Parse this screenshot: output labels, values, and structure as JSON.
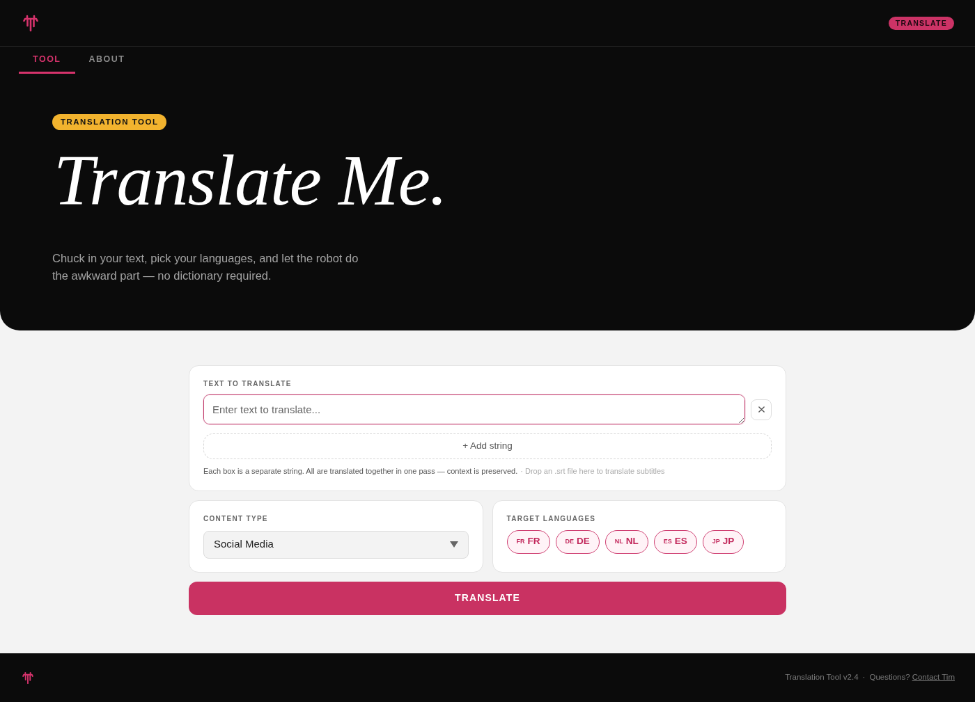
{
  "header": {
    "button": "TRANSLATE"
  },
  "tabs": [
    {
      "label": "TOOL",
      "selected": true
    },
    {
      "label": "ABOUT",
      "selected": false
    }
  ],
  "hero": {
    "tag": "TRANSLATION TOOL",
    "title": "Translate Me.",
    "description": "Chuck in your text, pick your languages, and let the robot do the awkward part — no dictionary required."
  },
  "text_panel": {
    "label": "TEXT TO TRANSLATE",
    "strings": [
      {
        "placeholder": "Enter text to translate...",
        "focused": true
      }
    ],
    "add_button": "+ Add string",
    "help": "Each box is a separate string. All are translated together in one pass — context is preserved.",
    "drop_hint": "· Drop an .srt file here to translate subtitles"
  },
  "content_type": {
    "label": "CONTENT TYPE",
    "value": "Social Media"
  },
  "target_languages": {
    "label": "TARGET LANGUAGES",
    "languages": [
      {
        "short": "FR",
        "label": "FR",
        "selected": true
      },
      {
        "short": "DE",
        "label": "DE",
        "selected": true
      },
      {
        "short": "NL",
        "label": "NL",
        "selected": true
      },
      {
        "short": "ES",
        "label": "ES",
        "selected": true
      },
      {
        "short": "JP",
        "label": "JP",
        "selected": true
      }
    ]
  },
  "translate_button": "TRANSLATE",
  "footer": {
    "version": "Translation Tool v2.4",
    "separator": "·",
    "question": "Questions?",
    "link": "Contact Tim"
  }
}
